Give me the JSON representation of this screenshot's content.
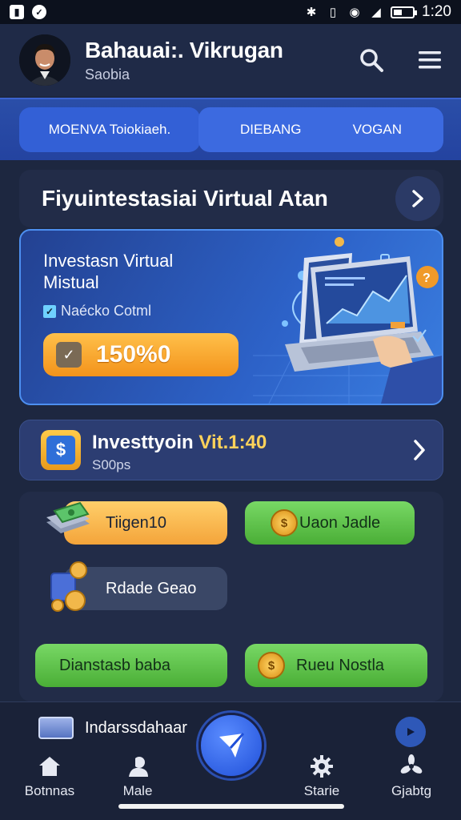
{
  "status_bar": {
    "time": "1:20",
    "left_icons": [
      "sim-icon",
      "shield-icon"
    ],
    "right_icons": [
      "bluetooth-icon",
      "vibrate-icon",
      "eye-icon",
      "signal-icon",
      "battery-icon"
    ]
  },
  "header": {
    "name": "Bahauai:. Vikrugan",
    "subtitle": "Saobia",
    "icons": [
      "search-icon",
      "menu-icon"
    ]
  },
  "tabs": [
    {
      "label": "MOENVA Toiokiaeh."
    },
    {
      "label": "DIEBANG"
    },
    {
      "label": "VOGAN"
    }
  ],
  "section": {
    "title": "Fiyuintestasiai Virtual Atan"
  },
  "hero": {
    "line1": "Investasn Virtual",
    "line2": "Mistual",
    "check_label": "Naécko Cotml",
    "percent": "150%0",
    "illustration": "laptop-chart-illustration"
  },
  "invest_card": {
    "title_main": "Investtyoin",
    "title_accent": "Vit.1:40",
    "subtitle": "S00ps"
  },
  "actions": [
    {
      "label": "Tiigen10",
      "style": "orange",
      "icon": "cash-stack-icon"
    },
    {
      "label": "Uaon Jadle",
      "style": "green",
      "icon": "coins-icon"
    },
    {
      "label": "Rdade Geao",
      "style": "gray",
      "icon": "gift-coins-icon"
    },
    {
      "label": "Dianstasb baba",
      "style": "green",
      "icon": ""
    },
    {
      "label": "Rueu Nostla",
      "style": "green",
      "icon": "gold-coin-icon"
    }
  ],
  "bottom_peek": {
    "label": "Indarssdahaar"
  },
  "nav": [
    {
      "label": "Botnnas",
      "icon": "home-icon"
    },
    {
      "label": "Male",
      "icon": "profile-icon"
    },
    {
      "label": "Starie",
      "icon": "gear-icon"
    },
    {
      "label": "Gjabtg",
      "icon": "fan-icon"
    }
  ],
  "colors": {
    "background": "#1d2740",
    "accent_blue": "#3360d6",
    "orange": "#f4a43a",
    "green": "#4aae36"
  }
}
